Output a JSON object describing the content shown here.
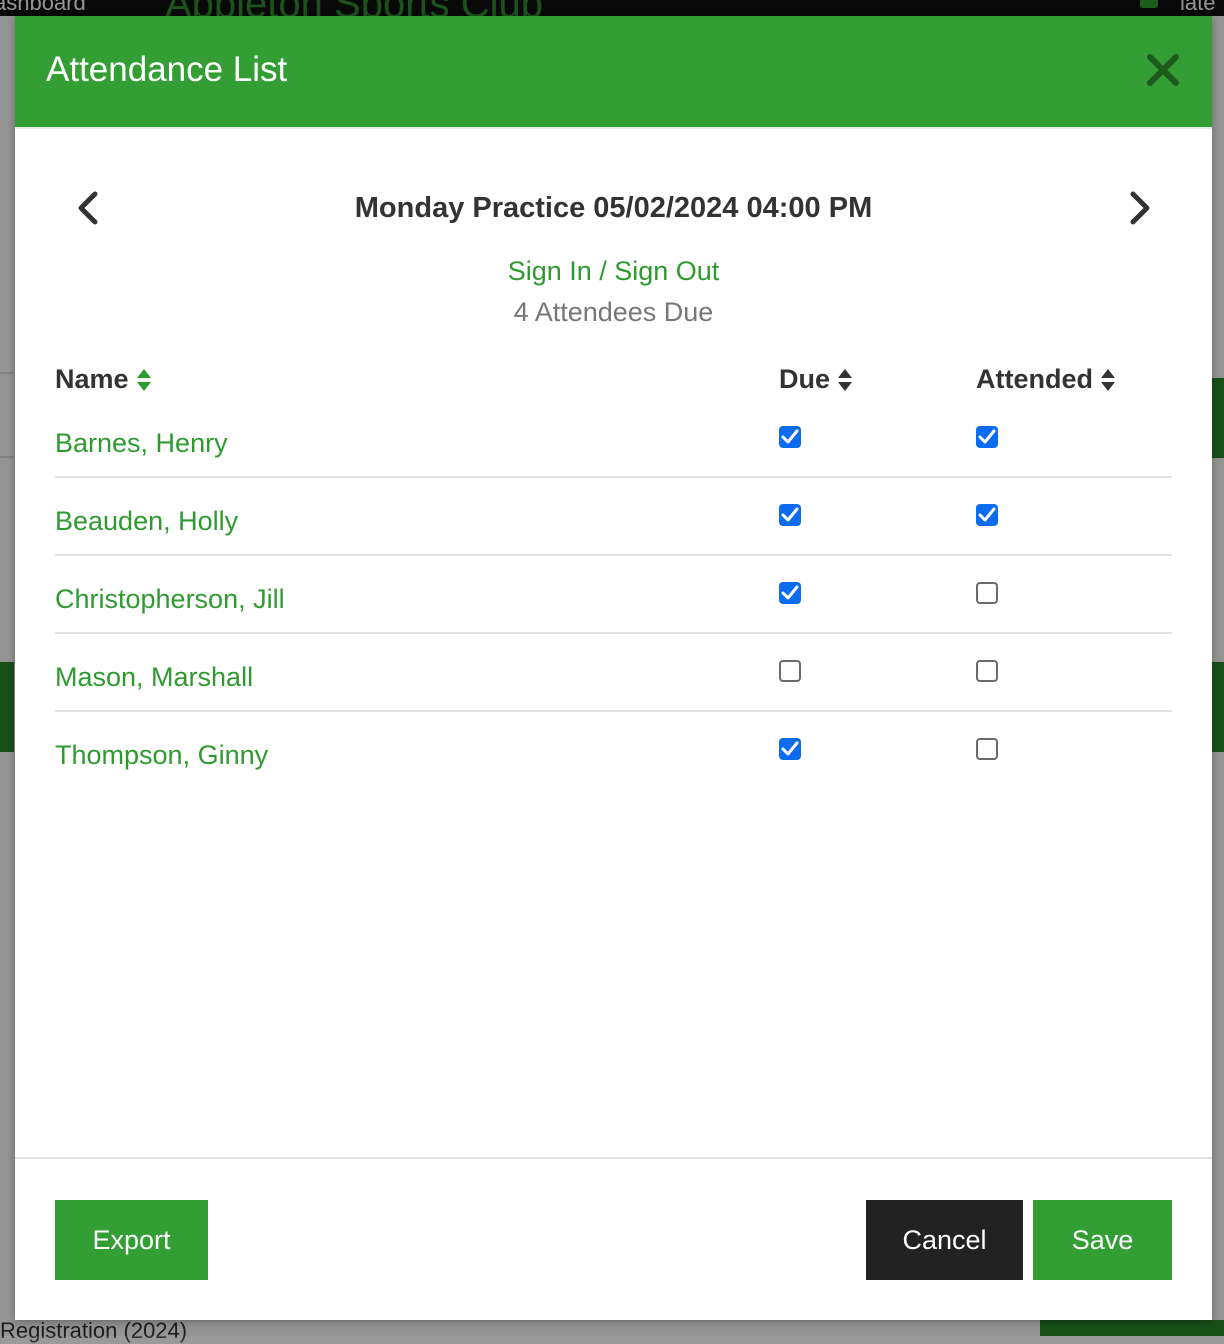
{
  "background": {
    "left_text": "ashboard",
    "club_name": "Appleton Sports Club",
    "right_text": "late",
    "bottom_text": "Registration (2024)"
  },
  "modal": {
    "title": "Attendance List",
    "session_title": "Monday Practice 05/02/2024 04:00 PM",
    "signin_link": "Sign In / Sign Out",
    "due_count": "4 Attendees Due",
    "columns": {
      "name": "Name",
      "due": "Due",
      "attended": "Attended"
    },
    "rows": [
      {
        "name": "Barnes, Henry",
        "due": true,
        "attended": true
      },
      {
        "name": "Beauden, Holly",
        "due": true,
        "attended": true
      },
      {
        "name": "Christopherson, Jill",
        "due": true,
        "attended": false
      },
      {
        "name": "Mason, Marshall",
        "due": false,
        "attended": false
      },
      {
        "name": "Thompson, Ginny",
        "due": true,
        "attended": false
      }
    ],
    "buttons": {
      "export": "Export",
      "cancel": "Cancel",
      "save": "Save"
    }
  },
  "colors": {
    "header_green": "#339e34",
    "link_green": "#2f9a2f",
    "checkbox_blue": "#0b6cf0",
    "cancel_dark": "#222222"
  },
  "icons": {
    "close": "close-icon",
    "prev": "chevron-left-icon",
    "next": "chevron-right-icon",
    "sort": "sort-icon",
    "check": "checkmark-icon"
  }
}
